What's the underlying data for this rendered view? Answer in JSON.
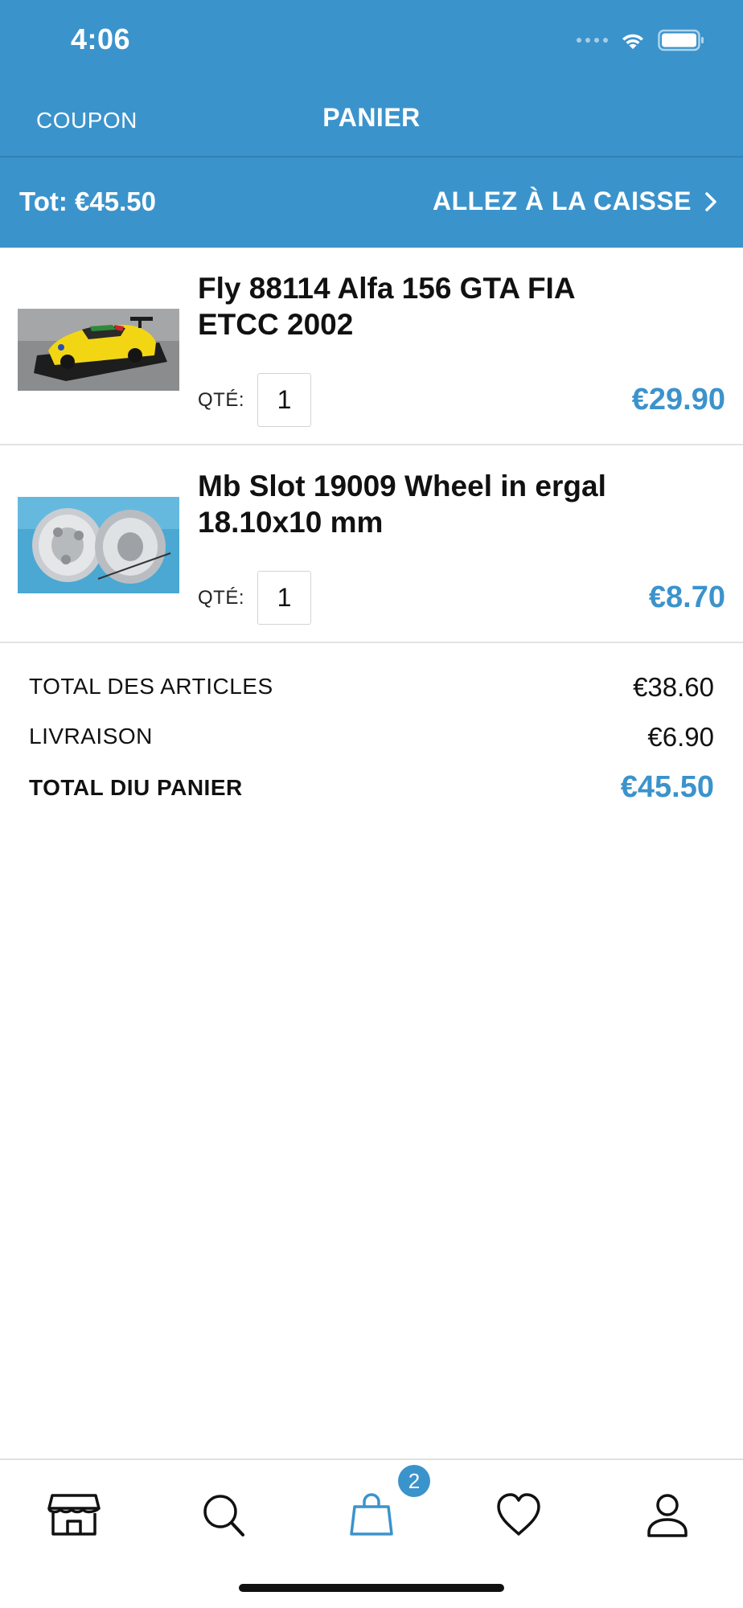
{
  "status_bar": {
    "time": "4:06"
  },
  "nav": {
    "coupon_label": "COUPON",
    "title": "PANIER"
  },
  "checkout": {
    "total_label": "Tot: €45.50",
    "button_label": "ALLEZ À LA CAISSE"
  },
  "items": [
    {
      "name": "Fly 88114 Alfa 156 GTA FIA ETCC 2002",
      "qty_label": "QTÉ:",
      "qty": "1",
      "price": "€29.90"
    },
    {
      "name": "Mb Slot 19009 Wheel in ergal 18.10x10 mm",
      "qty_label": "QTÉ:",
      "qty": "1",
      "price": "€8.70"
    }
  ],
  "summary": {
    "items_total_label": "TOTAL DES ARTICLES",
    "items_total_value": "€38.60",
    "shipping_label": "LIVRAISON",
    "shipping_value": "€6.90",
    "cart_total_label": "TOTAL DIU PANIER",
    "cart_total_value": "€45.50"
  },
  "tab_bar": {
    "tabs": [
      {
        "icon": "store-icon"
      },
      {
        "icon": "search-icon"
      },
      {
        "icon": "shopping-bag-icon"
      },
      {
        "icon": "heart-icon"
      },
      {
        "icon": "user-icon"
      }
    ],
    "cart_badge": "2"
  },
  "colors": {
    "accent": "#3b93cc",
    "text": "#111111",
    "divider": "#e3e3e3"
  }
}
